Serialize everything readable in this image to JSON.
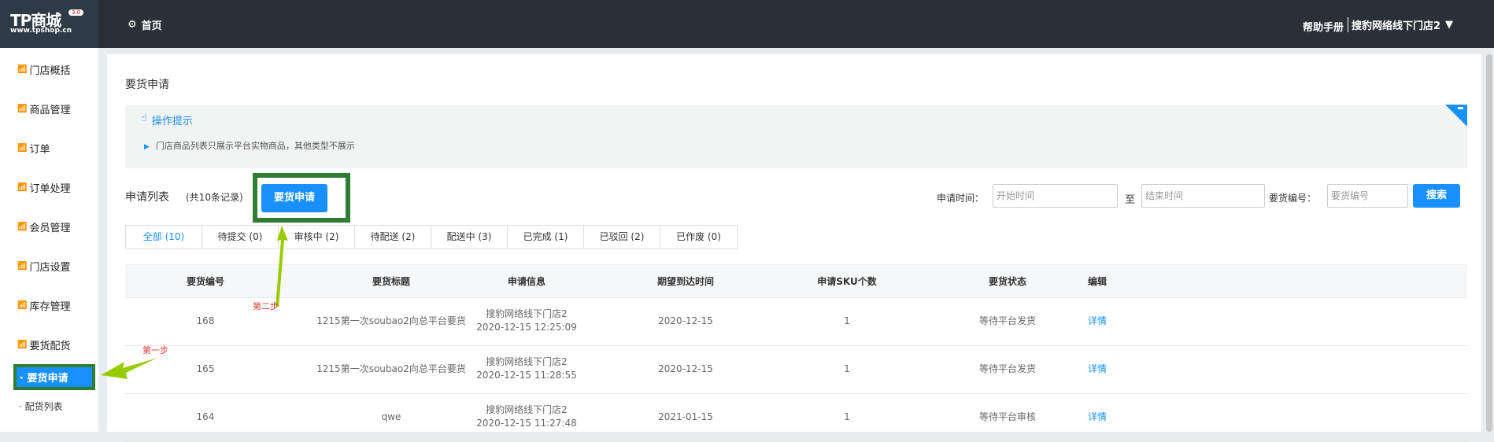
{
  "header": {
    "logo_text": "TP商城",
    "logo_version": "3.0",
    "logo_url": "www.tpshop.cn",
    "home": "首页",
    "help": "帮助手册",
    "store": "搜豹网络线下门店2"
  },
  "sidebar": {
    "items": [
      "门店概括",
      "商品管理",
      "订单",
      "订单处理",
      "会员管理",
      "门店设置",
      "库存管理",
      "要货配货"
    ],
    "subitems": [
      "要货申请",
      "配货列表"
    ]
  },
  "page": {
    "title": "要货申请",
    "tip_title": "操作提示",
    "tip_text": "门店商品列表只展示平台实物商品，其他类型不展示"
  },
  "list": {
    "label": "申请列表",
    "count": "(共10条记录)",
    "add_button": "要货申请"
  },
  "filters": {
    "time_label": "申请时间：",
    "start_placeholder": "开始时间",
    "to": "至",
    "end_placeholder": "结束时间",
    "no_label": "要货编号：",
    "no_placeholder": "要货编号",
    "search": "搜索"
  },
  "tabs": [
    "全部 (10)",
    "待提交 (0)",
    "审核中 (2)",
    "待配送 (2)",
    "配送中 (3)",
    "已完成 (1)",
    "已驳回 (2)",
    "已作废 (0)"
  ],
  "table": {
    "headers": [
      "要货编号",
      "要货标题",
      "申请信息",
      "期望到达时间",
      "申请SKU个数",
      "要货状态",
      "编辑"
    ],
    "rows": [
      {
        "id": "168",
        "title": "1215第一次soubao2向总平台要货",
        "store": "搜豹网络线下门店2",
        "time": "2020-12-15 12:25:09",
        "expect": "2020-12-15",
        "sku": "1",
        "status": "等待平台发货",
        "action": "详情"
      },
      {
        "id": "165",
        "title": "1215第一次soubao2向总平台要货",
        "store": "搜豹网络线下门店2",
        "time": "2020-12-15 11:28:55",
        "expect": "2020-12-15",
        "sku": "1",
        "status": "等待平台发货",
        "action": "详情"
      },
      {
        "id": "164",
        "title": "qwe",
        "store": "搜豹网络线下门店2",
        "time": "2020-12-15 11:27:48",
        "expect": "2021-01-15",
        "sku": "1",
        "status": "等待平台审核",
        "action": "详情"
      }
    ]
  },
  "annotations": {
    "step1": "第一步",
    "step2": "第二步"
  },
  "colors": {
    "accent": "#1890ff",
    "header": "#2b3038",
    "highlight": "#2e7d32",
    "arrow": "#99cc00",
    "annotation": "#e53935"
  }
}
